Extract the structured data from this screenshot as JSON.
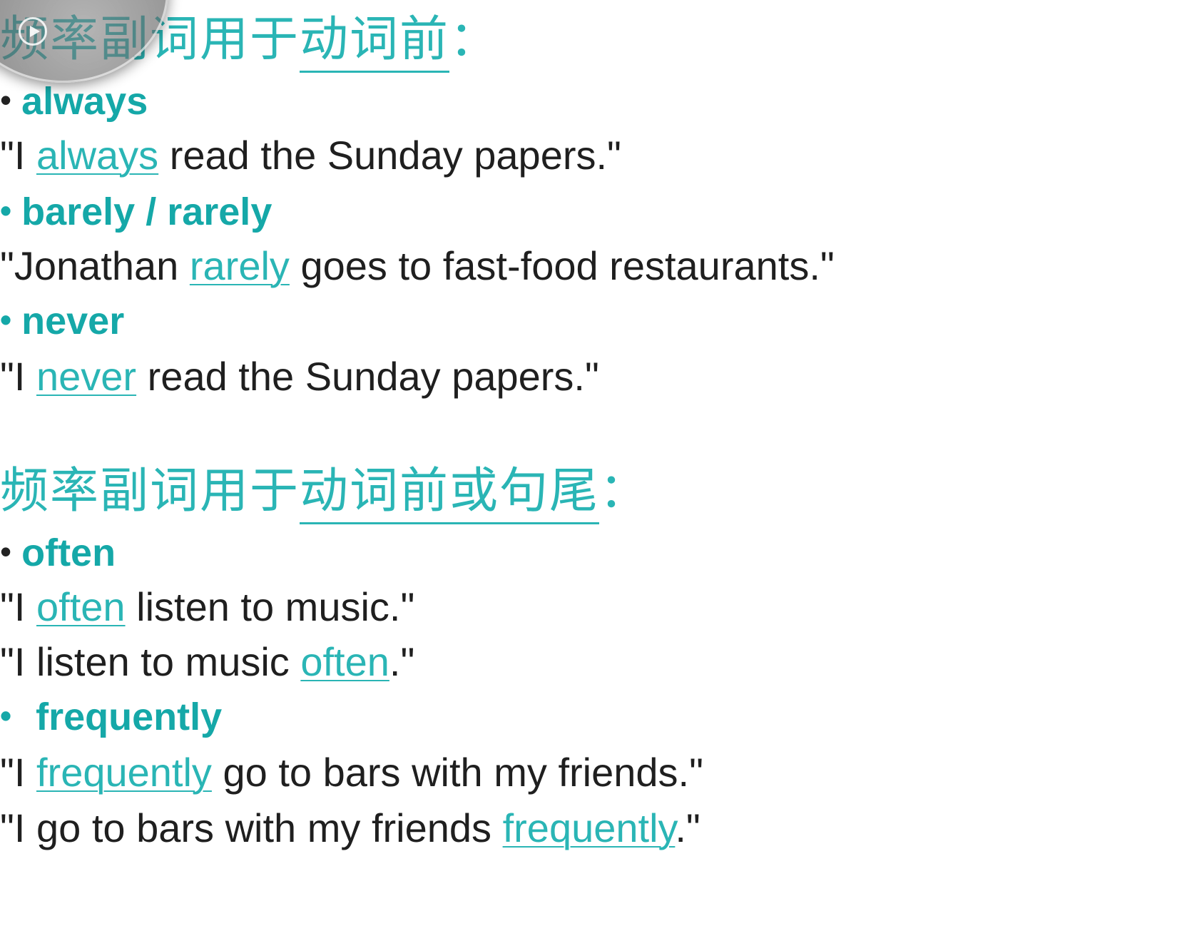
{
  "section1": {
    "heading_prefix": "频率副词用于",
    "heading_underlined": "动词前",
    "heading_suffix": "：",
    "items": [
      {
        "term": "always",
        "example": {
          "before": "\"I ",
          "keyword": "always",
          "after": " read the Sunday papers.\""
        }
      },
      {
        "term": "barely / rarely",
        "example": {
          "before": "\"Jonathan ",
          "keyword": "rarely",
          "after": " goes to fast-food restaurants.\""
        }
      },
      {
        "term": "never",
        "example": {
          "before": "\"I ",
          "keyword": "never",
          "after": " read the Sunday papers.\""
        }
      }
    ]
  },
  "section2": {
    "heading_prefix": "频率副词用于",
    "heading_underlined": "动词前或句尾",
    "heading_suffix": "：",
    "items": [
      {
        "term": "often",
        "examples": [
          {
            "before": "\"I ",
            "keyword": "often",
            "after": " listen to music.\""
          },
          {
            "before": "\"I listen to music ",
            "keyword": "often",
            "after": ".\""
          }
        ]
      },
      {
        "term": "frequently",
        "examples": [
          {
            "before": "\"I ",
            "keyword": "frequently",
            "after": " go to bars with my friends.\""
          },
          {
            "before": "\"I go to bars with my friends ",
            "keyword": "frequently",
            "after": ".\""
          }
        ]
      }
    ]
  },
  "bullet_glyph": "•",
  "colors": {
    "accent": "#2ab5b5",
    "bullet": "#15a8a8",
    "text": "#1f1f1f"
  }
}
